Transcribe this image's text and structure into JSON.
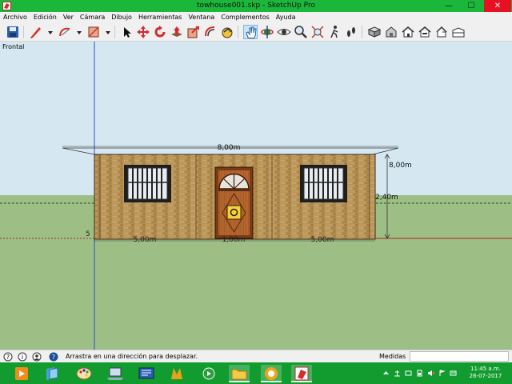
{
  "window": {
    "title": "towhouse001.skp - SketchUp Pro",
    "minimize_glyph": "—",
    "maximize_glyph": "☐",
    "close_glyph": "✕"
  },
  "menu": [
    "Archivo",
    "Edición",
    "Ver",
    "Cámara",
    "Dibujo",
    "Herramientas",
    "Ventana",
    "Complementos",
    "Ayuda"
  ],
  "toolbar": {
    "active_tool": "pan-tool",
    "tools": [
      "save",
      "pencil",
      "arc",
      "rectangle",
      "select",
      "move",
      "rotate",
      "push-pull",
      "scale",
      "offset",
      "follow-me",
      "pan",
      "orbit",
      "look-around",
      "zoom",
      "zoom-extents",
      "walk",
      "footprints",
      "components",
      "iso-view",
      "top-view",
      "front-view",
      "right-view",
      "back-view",
      "left-view"
    ]
  },
  "viewport": {
    "scene_label": "Frontal",
    "sky_color": "#d5e8f2",
    "ground_color": "#9dbf86",
    "dimensions": {
      "total_width": "8,00m",
      "depth": "8,00m",
      "height": "2,40m",
      "left_segment": "5,00m",
      "door_segment": "1,00m",
      "right_segment": "5,00m",
      "left_edge_number": "5"
    }
  },
  "status": {
    "hint": "Arrastra en una dirección para desplazar.",
    "measure_label": "Medidas",
    "measure_value": ""
  },
  "taskbar": {
    "apps": [
      "windows-media-player",
      "window-switcher",
      "paint",
      "windows-mobility",
      "remote-desktop",
      "winamp",
      "media-center",
      "file-explorer",
      "snagit",
      "sketchup"
    ],
    "time": "11:45 a.m.",
    "date": "26-07-2017"
  }
}
